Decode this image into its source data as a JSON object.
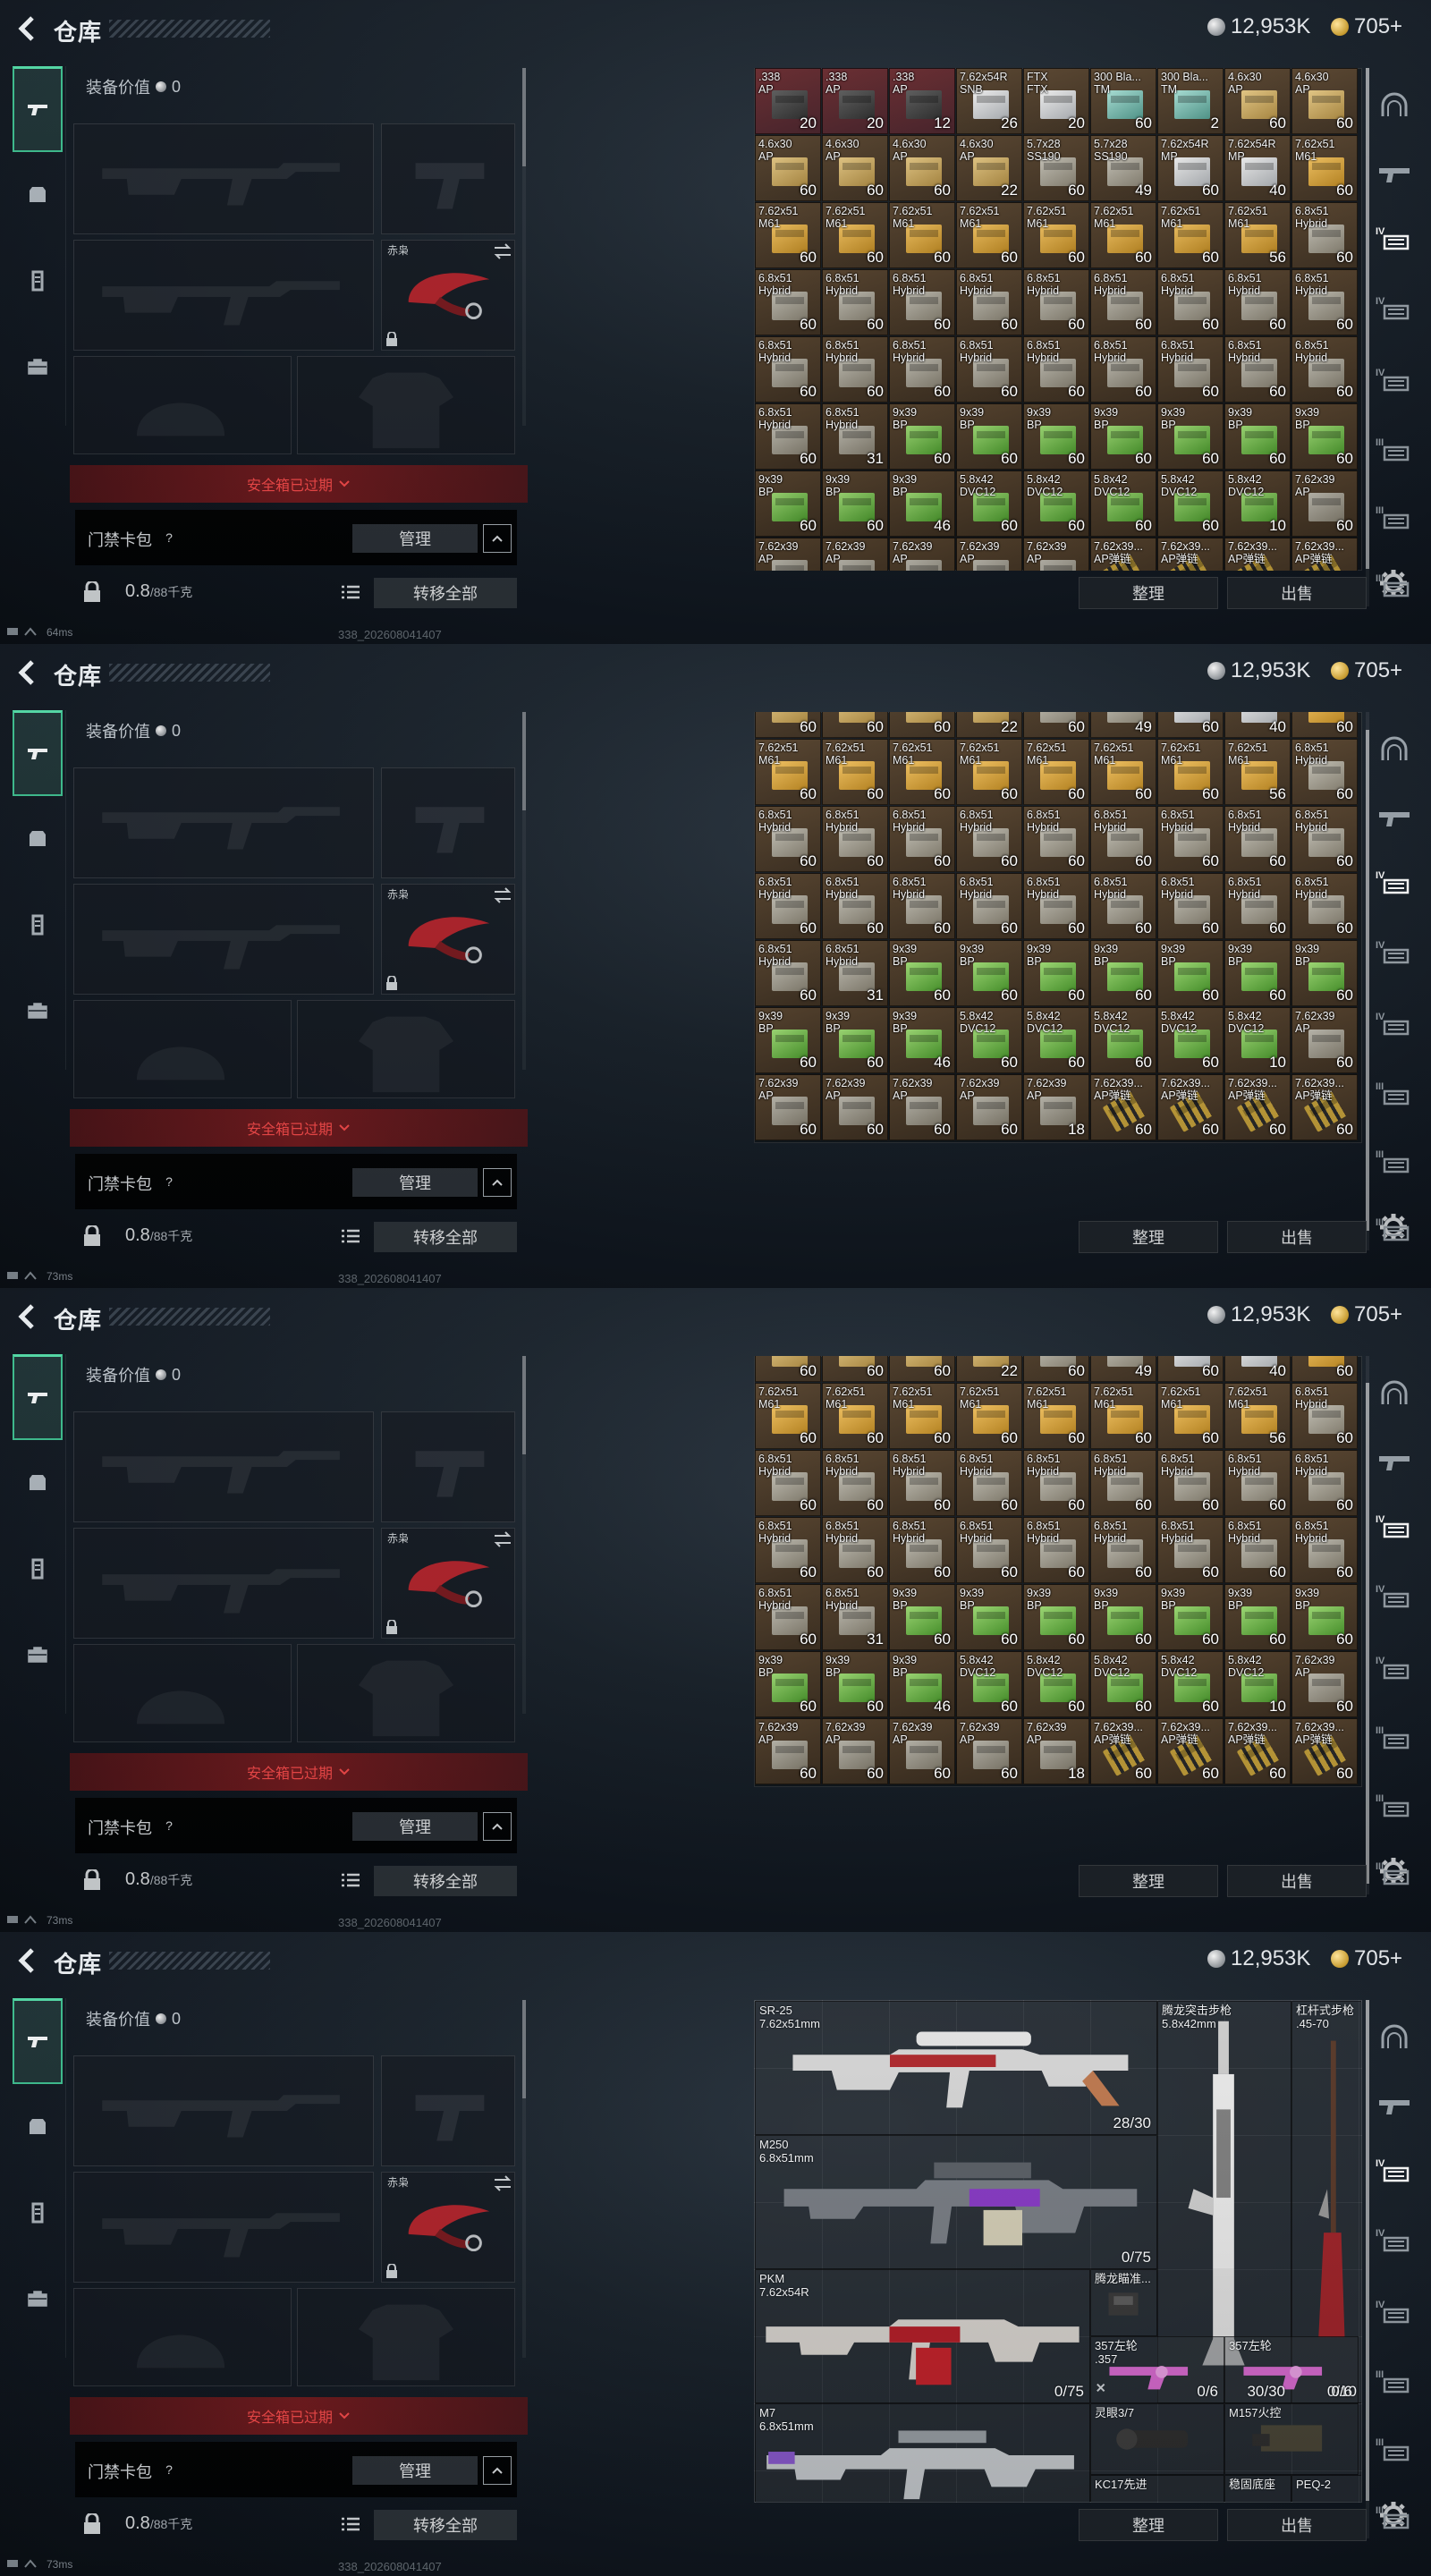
{
  "header": {
    "title": "仓库",
    "silver": "12,953K",
    "gold": "705+"
  },
  "left": {
    "equip_value_label": "装备价值",
    "equip_value": "0",
    "knife_label": "赤枭",
    "safe_box_text": "安全箱已过期",
    "keycard_label": "门禁卡包",
    "help": "?",
    "manage": "管理",
    "weight_value": "0.8",
    "weight_cap": "/88千克",
    "transfer_all": "转移全部"
  },
  "footer_buttons": {
    "sort": "整理",
    "sell": "出售"
  },
  "status": {
    "pings": [
      "64ms",
      "73ms",
      "73ms",
      "73ms"
    ],
    "build": "338_202608041407"
  },
  "right_tab_icons": [
    "helmet-icon",
    "rifle-icon",
    "ammo-tier-iv-icon",
    "ammo-tier-iv-icon",
    "ammo-tier-iv-icon",
    "ammo-tier-iii-icon",
    "ammo-tier-iii-icon",
    "ammo-tier-iii-icon"
  ],
  "ammo_rows": [
    [
      [
        ".338\nAP",
        "20",
        "red",
        "dark"
      ],
      [
        ".338\nAP",
        "20",
        "red",
        "dark"
      ],
      [
        ".338\nAP",
        "12",
        "red",
        "dark"
      ],
      [
        "7.62x54R\nSNB",
        "26",
        "brown",
        "white"
      ],
      [
        "FTX\nFTX",
        "20",
        "brown",
        "white"
      ],
      [
        "300 Bla...\nTM",
        "60",
        "brown",
        "teal"
      ],
      [
        "300 Bla...\nTM",
        "2",
        "brown",
        "teal"
      ],
      [
        "4.6x30\nAP",
        "60",
        "brown",
        "tan"
      ],
      [
        "4.6x30\nAP",
        "60",
        "brown",
        "tan"
      ]
    ],
    [
      [
        "4.6x30\nAP",
        "60",
        "brown",
        "tan"
      ],
      [
        "4.6x30\nAP",
        "60",
        "brown",
        "tan"
      ],
      [
        "4.6x30\nAP",
        "60",
        "brown",
        "tan"
      ],
      [
        "4.6x30\nAP",
        "22",
        "brown",
        "tan"
      ],
      [
        "5.7x28\nSS190",
        "60",
        "brown",
        "grey"
      ],
      [
        "5.7x28\nSS190",
        "49",
        "brown",
        "grey"
      ],
      [
        "7.62x54R\nMP",
        "60",
        "brown",
        "white"
      ],
      [
        "7.62x54R\nMP",
        "40",
        "brown",
        "white"
      ],
      [
        "7.62x51\nM61",
        "60",
        "brown",
        "orange"
      ]
    ],
    [
      [
        "7.62x51\nM61",
        "60",
        "brown",
        "orange"
      ],
      [
        "7.62x51\nM61",
        "60",
        "brown",
        "orange"
      ],
      [
        "7.62x51\nM61",
        "60",
        "brown",
        "orange"
      ],
      [
        "7.62x51\nM61",
        "60",
        "brown",
        "orange"
      ],
      [
        "7.62x51\nM61",
        "60",
        "brown",
        "orange"
      ],
      [
        "7.62x51\nM61",
        "60",
        "brown",
        "orange"
      ],
      [
        "7.62x51\nM61",
        "60",
        "brown",
        "orange"
      ],
      [
        "7.62x51\nM61",
        "56",
        "brown",
        "orange"
      ],
      [
        "6.8x51\nHybrid",
        "60",
        "brown",
        "grey"
      ]
    ],
    [
      [
        "6.8x51\nHybrid",
        "60",
        "brown",
        "grey"
      ],
      [
        "6.8x51\nHybrid",
        "60",
        "brown",
        "grey"
      ],
      [
        "6.8x51\nHybrid",
        "60",
        "brown",
        "grey"
      ],
      [
        "6.8x51\nHybrid",
        "60",
        "brown",
        "grey"
      ],
      [
        "6.8x51\nHybrid",
        "60",
        "brown",
        "grey"
      ],
      [
        "6.8x51\nHybrid",
        "60",
        "brown",
        "grey"
      ],
      [
        "6.8x51\nHybrid",
        "60",
        "brown",
        "grey"
      ],
      [
        "6.8x51\nHybrid",
        "60",
        "brown",
        "grey"
      ],
      [
        "6.8x51\nHybrid",
        "60",
        "brown",
        "grey"
      ]
    ],
    [
      [
        "6.8x51\nHybrid",
        "60",
        "brown",
        "grey"
      ],
      [
        "6.8x51\nHybrid",
        "60",
        "brown",
        "grey"
      ],
      [
        "6.8x51\nHybrid",
        "60",
        "brown",
        "grey"
      ],
      [
        "6.8x51\nHybrid",
        "60",
        "brown",
        "grey"
      ],
      [
        "6.8x51\nHybrid",
        "60",
        "brown",
        "grey"
      ],
      [
        "6.8x51\nHybrid",
        "60",
        "brown",
        "grey"
      ],
      [
        "6.8x51\nHybrid",
        "60",
        "brown",
        "grey"
      ],
      [
        "6.8x51\nHybrid",
        "60",
        "brown",
        "grey"
      ],
      [
        "6.8x51\nHybrid",
        "60",
        "brown",
        "grey"
      ]
    ],
    [
      [
        "6.8x51\nHybrid",
        "60",
        "brown",
        "grey"
      ],
      [
        "6.8x51\nHybrid",
        "31",
        "brown",
        "grey"
      ],
      [
        "9x39\nBP",
        "60",
        "brown",
        "green"
      ],
      [
        "9x39\nBP",
        "60",
        "brown",
        "green"
      ],
      [
        "9x39\nBP",
        "60",
        "brown",
        "green"
      ],
      [
        "9x39\nBP",
        "60",
        "brown",
        "green"
      ],
      [
        "9x39\nBP",
        "60",
        "brown",
        "green"
      ],
      [
        "9x39\nBP",
        "60",
        "brown",
        "green"
      ],
      [
        "9x39\nBP",
        "60",
        "brown",
        "green"
      ]
    ],
    [
      [
        "9x39\nBP",
        "60",
        "brown",
        "green"
      ],
      [
        "9x39\nBP",
        "60",
        "brown",
        "green"
      ],
      [
        "9x39\nBP",
        "46",
        "brown",
        "green"
      ],
      [
        "5.8x42\nDVC12",
        "60",
        "brown",
        "green"
      ],
      [
        "5.8x42\nDVC12",
        "60",
        "brown",
        "green"
      ],
      [
        "5.8x42\nDVC12",
        "60",
        "brown",
        "green"
      ],
      [
        "5.8x42\nDVC12",
        "60",
        "brown",
        "green"
      ],
      [
        "5.8x42\nDVC12",
        "10",
        "brown",
        "green"
      ],
      [
        "7.62x39\nAP",
        "60",
        "brown",
        "grey"
      ]
    ],
    [
      [
        "7.62x39\nAP",
        "60",
        "brown",
        "grey"
      ],
      [
        "7.62x39\nAP",
        "60",
        "brown",
        "grey"
      ],
      [
        "7.62x39\nAP",
        "60",
        "brown",
        "grey"
      ],
      [
        "7.62x39\nAP",
        "60",
        "brown",
        "grey"
      ],
      [
        "7.62x39\nAP",
        "18",
        "brown",
        "grey"
      ],
      [
        "7.62x39...\nAP弹链",
        "60",
        "brown",
        "rounds"
      ],
      [
        "7.62x39...\nAP弹链",
        "60",
        "brown",
        "rounds"
      ],
      [
        "7.62x39...\nAP弹链",
        "60",
        "brown",
        "rounds"
      ],
      [
        "7.62x39...\nAP弹链",
        "60",
        "brown",
        "rounds"
      ]
    ]
  ],
  "weapons": [
    {
      "name": "SR-25\n7.62x51mm",
      "ammo": "28/30"
    },
    {
      "name": "腾龙突击步枪\n5.8x42mm",
      "ammo": "30/30"
    },
    {
      "name": "杠杆式步枪\n.45-70",
      "ammo": "0/10"
    },
    {
      "name": "M250\n6.8x51mm",
      "ammo": "0/75"
    },
    {
      "name": "PKM\n7.62x54R",
      "ammo": "0/75"
    },
    {
      "name": "腾龙瞄准...",
      "ammo": ""
    },
    {
      "name": "357左轮\n.357",
      "ammo": "0/6"
    },
    {
      "name": "357左轮",
      "ammo": "0/6"
    },
    {
      "name": "M7\n6.8x51mm",
      "ammo": ""
    },
    {
      "name": "灵眼3/7",
      "ammo": ""
    },
    {
      "name": "M157火控",
      "ammo": ""
    },
    {
      "name": "KC17先进",
      "ammo": ""
    },
    {
      "name": "稳固底座",
      "ammo": ""
    },
    {
      "name": "PEQ-2",
      "ammo": ""
    }
  ]
}
